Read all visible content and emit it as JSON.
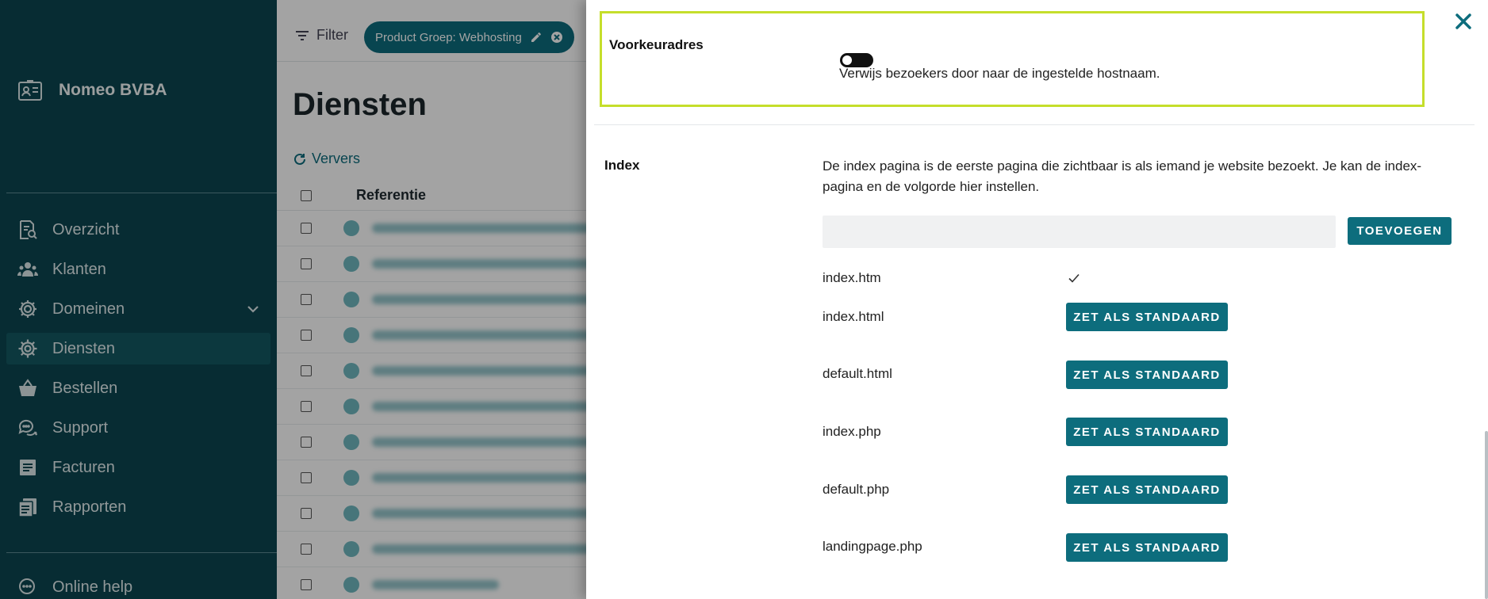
{
  "sidebar": {
    "company": "Nomeo BVBA",
    "items": [
      {
        "label": "Overzicht",
        "icon": "search-doc-icon"
      },
      {
        "label": "Klanten",
        "icon": "users-icon"
      },
      {
        "label": "Domeinen",
        "icon": "gear-icon"
      },
      {
        "label": "Diensten",
        "icon": "services-gear-icon"
      },
      {
        "label": "Bestellen",
        "icon": "basket-icon"
      },
      {
        "label": "Support",
        "icon": "chat-icon"
      },
      {
        "label": "Facturen",
        "icon": "invoice-icon"
      },
      {
        "label": "Rapporten",
        "icon": "reports-icon"
      }
    ],
    "help": "Online help"
  },
  "topbar": {
    "filter_label": "Filter",
    "chip_label": "Product Groep: Webhosting"
  },
  "main": {
    "title": "Diensten",
    "refresh_label": "Ververs",
    "table_header": "Referentie"
  },
  "panel": {
    "preferred": {
      "label": "Voorkeuradres",
      "description": "Verwijs bezoekers door naar de ingestelde hostnaam.",
      "enabled": false
    },
    "index": {
      "label": "Index",
      "description": "De index pagina is de eerste pagina die zichtbaar is als iemand je website bezoekt. Je kan de index-pagina en de volgorde hier instellen.",
      "input_value": "",
      "add_button": "TOEVOEGEN",
      "default_button": "ZET ALS STANDAARD",
      "pages": [
        "index.htm",
        "index.html",
        "default.html",
        "index.php",
        "default.php",
        "landingpage.php"
      ]
    }
  },
  "colors": {
    "sidebar": "#0b4650",
    "accent": "#0d6d7d",
    "highlight": "#c5de2b"
  }
}
